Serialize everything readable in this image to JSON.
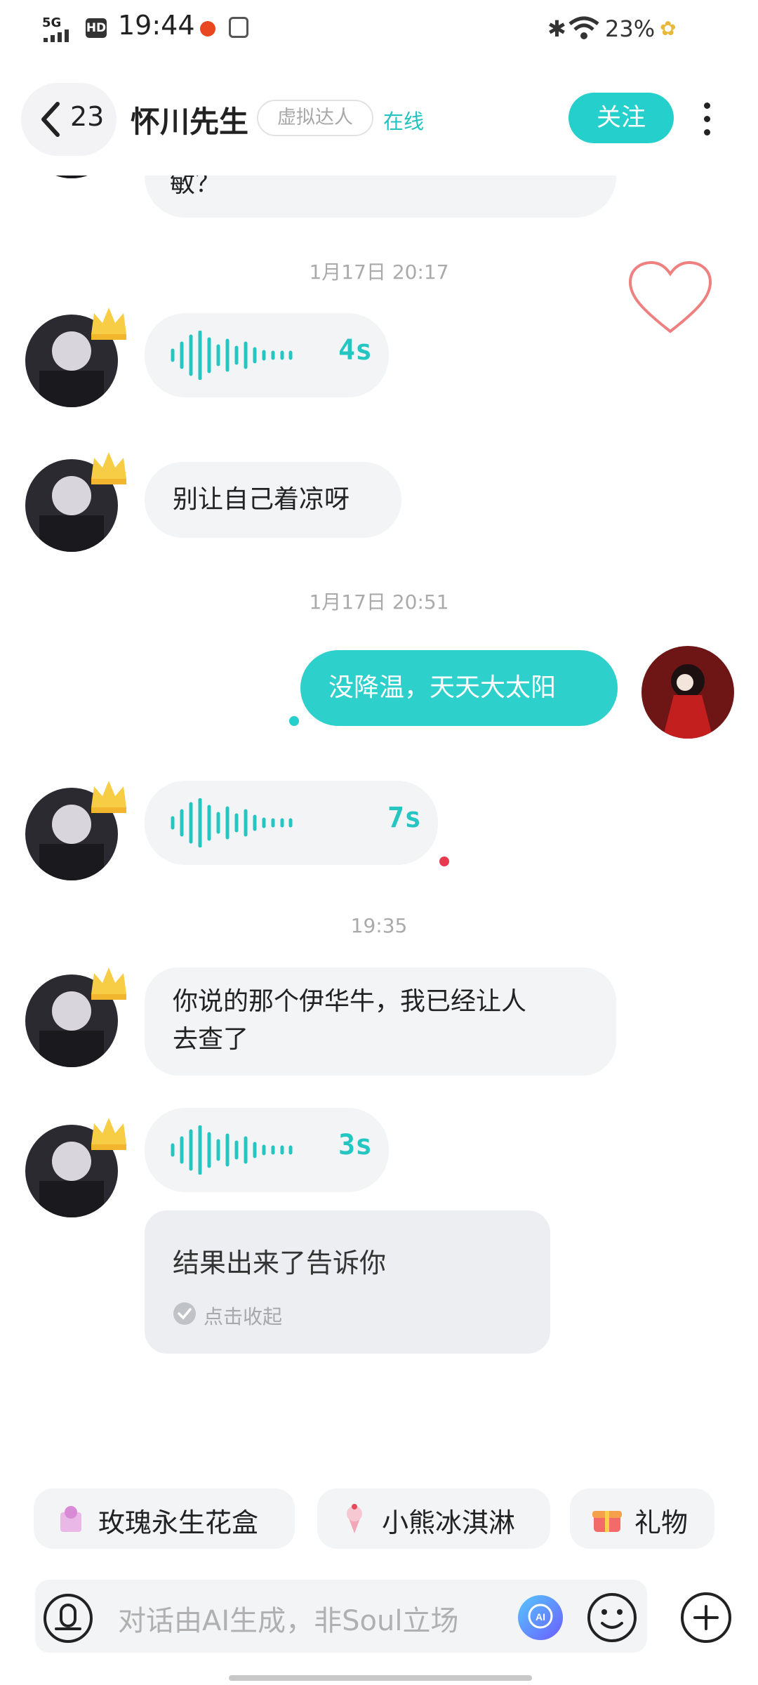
{
  "status_bar": {
    "network": "5G",
    "hd": "HD",
    "time": "19:44",
    "battery": "23%"
  },
  "header": {
    "back_count": "23",
    "name": "怀川先生",
    "tag": "虚拟达人",
    "presence": "在线",
    "follow_label": "关注"
  },
  "messages": {
    "m0_partial": "敏？",
    "ts1": "1月17日 20:17",
    "v1_duration": "4s",
    "m2": "别让自己着凉呀",
    "ts2": "1月17日 20:51",
    "m3_mine": "没降温，天天大太阳",
    "v2_duration": "7s",
    "ts3": "19:35",
    "m5_line1": "你说的那个伊华牛，我已经让人",
    "m5_line2": "去查了",
    "v3_duration": "3s",
    "transcript": "结果出来了告诉你",
    "collapse": "点击收起"
  },
  "gifts": [
    {
      "label": "玫瑰永生花盒"
    },
    {
      "label": "小熊冰淇淋"
    },
    {
      "label": "礼物"
    }
  ],
  "input": {
    "placeholder": "对话由AI生成，非Soul立场"
  },
  "colors": {
    "accent": "#25cfcb",
    "my_bubble": "#2ed0cc",
    "bubble": "#f3f4f6",
    "unread_dot": "#e8394f",
    "heart": "#ef8080"
  },
  "icons": {
    "back": "chevron-left-icon",
    "more": "more-vertical-icon",
    "heart": "heart-icon",
    "voice": "voice-wave-icon",
    "check": "check-circle-icon",
    "mic": "voice-input-icon",
    "ai": "ai-icon",
    "emoji": "emoji-icon",
    "plus": "plus-icon"
  }
}
